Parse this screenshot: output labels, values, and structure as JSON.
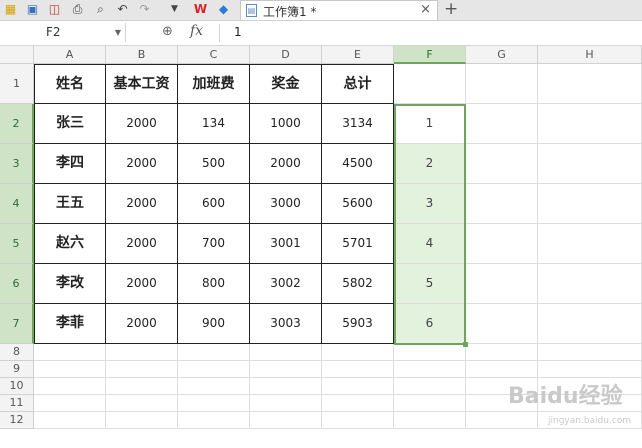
{
  "toolbar": {
    "icons": [
      "logo-icon",
      "save-icon",
      "export-pdf-icon",
      "print-icon",
      "print-preview-icon",
      "undo-icon",
      "redo-icon",
      "dropdown-icon",
      "wps-icon",
      "cube-icon"
    ],
    "tab_title": "工作簿1 *",
    "tab_close": "×",
    "new_tab": "+"
  },
  "formula_bar": {
    "name_box": "F2",
    "fx": "fx",
    "value": "1"
  },
  "columns": [
    "A",
    "B",
    "C",
    "D",
    "E",
    "F",
    "G",
    "H"
  ],
  "rows": [
    "1",
    "2",
    "3",
    "4",
    "5",
    "6",
    "7",
    "8",
    "9",
    "10",
    "11",
    "12"
  ],
  "selected_column": "F",
  "table": {
    "headers": [
      "姓名",
      "基本工资",
      "加班费",
      "奖金",
      "总计"
    ],
    "rows": [
      [
        "张三",
        "2000",
        "134",
        "1000",
        "3134"
      ],
      [
        "李四",
        "2000",
        "500",
        "2000",
        "4500"
      ],
      [
        "王五",
        "2000",
        "600",
        "3000",
        "5600"
      ],
      [
        "赵六",
        "2000",
        "700",
        "3001",
        "5701"
      ],
      [
        "李改",
        "2000",
        "800",
        "3002",
        "5802"
      ],
      [
        "李菲",
        "2000",
        "900",
        "3003",
        "5903"
      ]
    ]
  },
  "f_column": [
    "1",
    "2",
    "3",
    "4",
    "5",
    "6"
  ],
  "watermark": {
    "main": "Baidu经验",
    "sub": "jingyan.baidu.com"
  },
  "colors": {
    "selection": "#6ea55a",
    "selection_fill": "#e2f2dd"
  }
}
